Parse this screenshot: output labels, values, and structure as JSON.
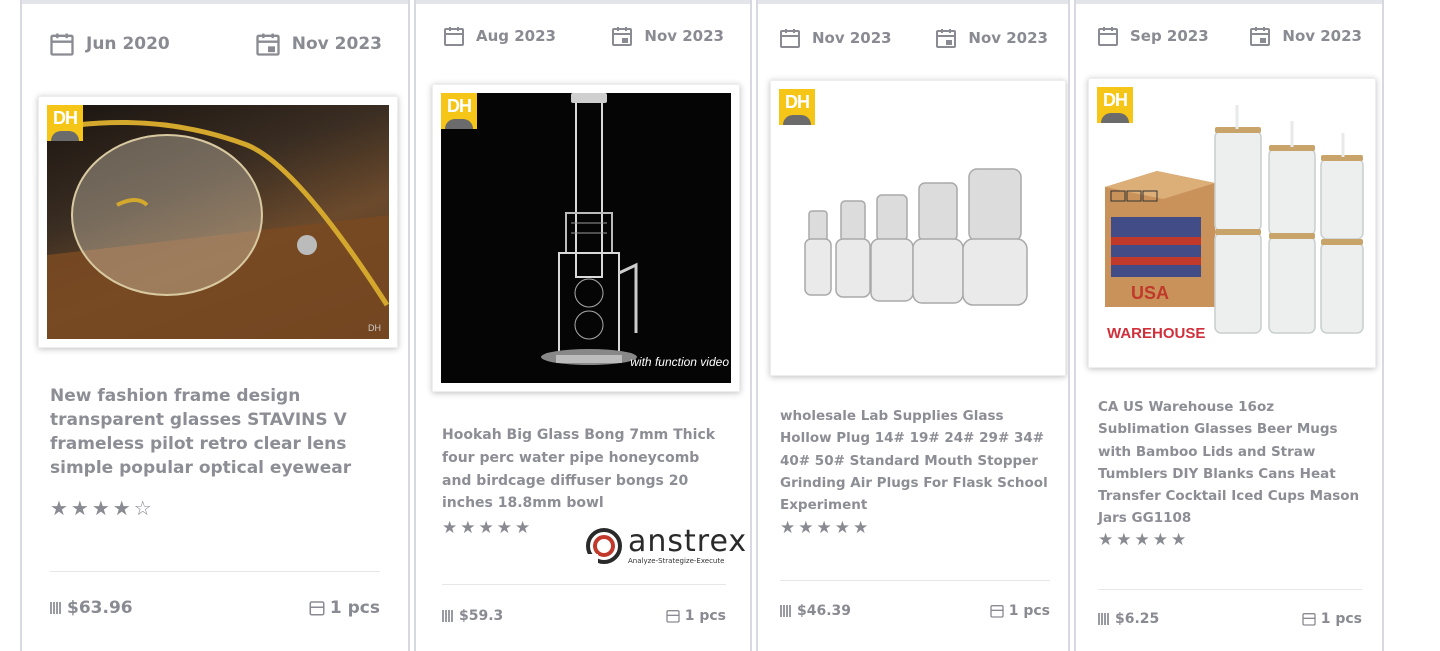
{
  "products": [
    {
      "first_seen": "Jun 2020",
      "last_seen": "Nov 2023",
      "badge": "DH",
      "title": "New fashion frame design transparent glasses STAVINS V frameless pilot retro clear lens simple popular optical eyewear",
      "rating_stars": "★★★★☆",
      "rating": 4,
      "price": "$63.96",
      "quantity": "1 pcs",
      "photo_watermark": "DH",
      "image_alt": "gold-frame-glasses-photo"
    },
    {
      "first_seen": "Aug 2023",
      "last_seen": "Nov 2023",
      "badge": "DH",
      "title": "Hookah Big Glass Bong 7mm Thick four perc water pipe honeycomb and birdcage diffuser bongs 20 inches 18.8mm bowl",
      "rating_stars": "★★★★★",
      "rating": 5,
      "price": "$59.3",
      "quantity": "1 pcs",
      "photo_caption": "with function video",
      "image_alt": "glass-bong-photo"
    },
    {
      "first_seen": "Nov 2023",
      "last_seen": "Nov 2023",
      "badge": "DH",
      "title": "wholesale Lab Supplies Glass Hollow Plug 14# 19# 24# 29# 34# 40# 50# Standard Mouth Stopper Grinding Air Plugs For Flask School Experiment",
      "rating_stars": "★★★★★",
      "rating": 5,
      "price": "$46.39",
      "quantity": "1 pcs",
      "image_alt": "glass-stoppers-photo"
    },
    {
      "first_seen": "Sep 2023",
      "last_seen": "Nov 2023",
      "badge": "DH",
      "title": "CA US Warehouse 16oz Sublimation Glasses Beer Mugs with Bamboo Lids and Straw Tumblers DIY Blanks Cans Heat Transfer Cocktail Iced Cups Mason Jars GG1108",
      "rating_stars": "★★★★★",
      "rating": 5,
      "price": "$6.25",
      "quantity": "1 pcs",
      "photo_text_usa": "USA",
      "photo_text_warehouse": "WAREHOUSE",
      "image_alt": "sublimation-glasses-photo"
    }
  ],
  "watermark": {
    "brand": "anstrex",
    "tagline": "Analyze-Strategize-Execute"
  },
  "colors": {
    "text_muted": "#8d8e95",
    "badge_yellow": "#f5c518",
    "card_border": "#d8d9e0"
  }
}
